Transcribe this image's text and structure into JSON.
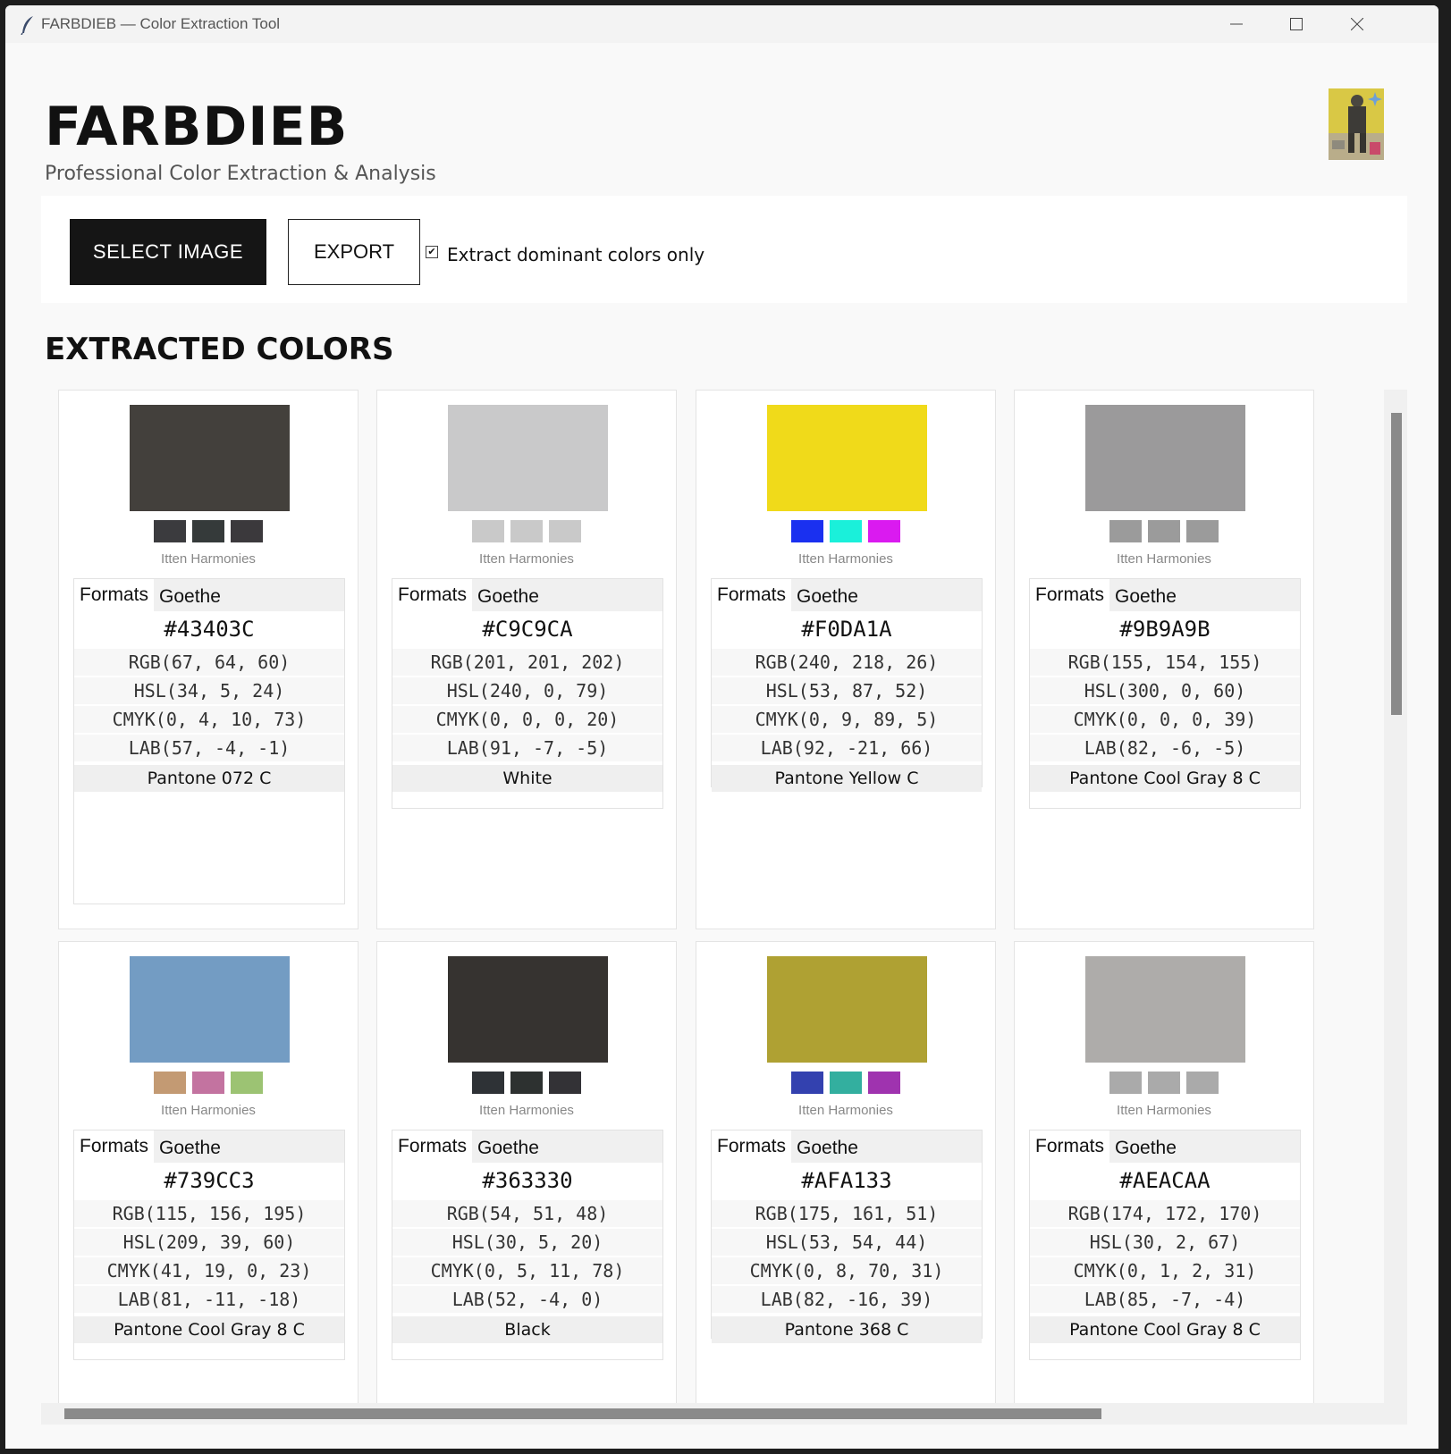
{
  "window": {
    "title": "FARBDIEB — Color Extraction Tool",
    "app_icon": "feather-icon"
  },
  "header": {
    "title": "FARBDIEB",
    "subtitle": "Professional Color Extraction & Analysis"
  },
  "toolbar": {
    "select_label": "SELECT IMAGE",
    "export_label": "EXPORT",
    "checkbox_label": "Extract dominant colors only",
    "checkbox_checked": true,
    "checkbox_glyph": "✔"
  },
  "section": {
    "title": "EXTRACTED COLORS"
  },
  "harmonies_label": "Itten Harmonies",
  "tab_labels": [
    "Formats",
    "Goethe"
  ],
  "cards": [
    {
      "swatch": "#43403C",
      "harmonies": [
        "#3b3b3e",
        "#353a3a",
        "#3b393c"
      ],
      "hex": "#43403C",
      "rgb": "RGB(67, 64, 60)",
      "hsl": "HSL(34, 5, 24)",
      "cmyk": "CMYK(0, 4, 10, 73)",
      "lab": "LAB(57, -4, -1)",
      "pantone": "Pantone 072 C"
    },
    {
      "swatch": "#C9C9CA",
      "harmonies": [
        "#c9c9c9",
        "#c9c9c9",
        "#c9c9c9"
      ],
      "hex": "#C9C9CA",
      "rgb": "RGB(201, 201, 202)",
      "hsl": "HSL(240, 0, 79)",
      "cmyk": "CMYK(0, 0, 0, 20)",
      "lab": "LAB(91, -7, -5)",
      "pantone": "White"
    },
    {
      "swatch": "#F0DA1A",
      "harmonies": [
        "#1a30f0",
        "#1af0da",
        "#da1af0"
      ],
      "hex": "#F0DA1A",
      "rgb": "RGB(240, 218, 26)",
      "hsl": "HSL(53, 87, 52)",
      "cmyk": "CMYK(0, 9, 89, 5)",
      "lab": "LAB(92, -21, 66)",
      "pantone": "Pantone Yellow C"
    },
    {
      "swatch": "#9B9A9B",
      "harmonies": [
        "#9b9b9b",
        "#9b9b9b",
        "#9b9b9b"
      ],
      "hex": "#9B9A9B",
      "rgb": "RGB(155, 154, 155)",
      "hsl": "HSL(300, 0, 60)",
      "cmyk": "CMYK(0, 0, 0, 39)",
      "lab": "LAB(82, -6, -5)",
      "pantone": "Pantone Cool Gray 8 C"
    },
    {
      "swatch": "#739CC3",
      "harmonies": [
        "#c39a73",
        "#c373a0",
        "#9cc373"
      ],
      "hex": "#739CC3",
      "rgb": "RGB(115, 156, 195)",
      "hsl": "HSL(209, 39, 60)",
      "cmyk": "CMYK(41, 19, 0, 23)",
      "lab": "LAB(81, -11, -18)",
      "pantone": "Pantone Cool Gray 8 C"
    },
    {
      "swatch": "#363330",
      "harmonies": [
        "#2e3236",
        "#2d3130",
        "#333236"
      ],
      "hex": "#363330",
      "rgb": "RGB(54, 51, 48)",
      "hsl": "HSL(30, 5, 20)",
      "cmyk": "CMYK(0, 5, 11, 78)",
      "lab": "LAB(52, -4, 0)",
      "pantone": "Black"
    },
    {
      "swatch": "#AFA133",
      "harmonies": [
        "#3341af",
        "#33af9f",
        "#9f33af"
      ],
      "hex": "#AFA133",
      "rgb": "RGB(175, 161, 51)",
      "hsl": "HSL(53, 54, 44)",
      "cmyk": "CMYK(0, 8, 70, 31)",
      "lab": "LAB(82, -16, 39)",
      "pantone": "Pantone 368 C"
    },
    {
      "swatch": "#AEACAA",
      "harmonies": [
        "#aaaaaa",
        "#aaaaaa",
        "#aaaaaa"
      ],
      "hex": "#AEACAA",
      "rgb": "RGB(174, 172, 170)",
      "hsl": "HSL(30, 2, 67)",
      "cmyk": "CMYK(0, 1, 2, 31)",
      "lab": "LAB(85, -7, -4)",
      "pantone": "Pantone Cool Gray 8 C"
    }
  ]
}
